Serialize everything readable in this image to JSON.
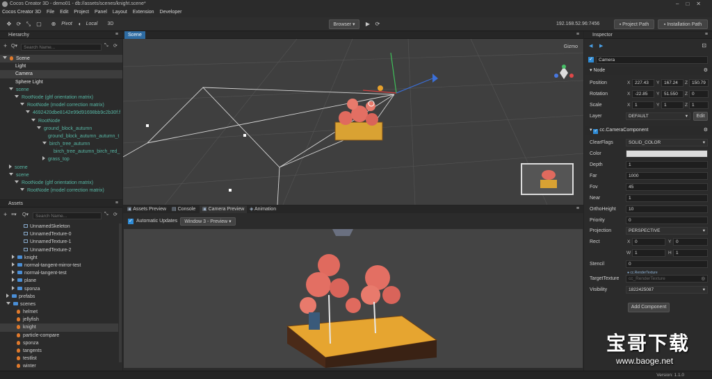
{
  "window": {
    "title": "Cocos Creator 3D - demo01 - db://assets/scenes/knight.scene*"
  },
  "menu": [
    "Cocos Creator 3D",
    "File",
    "Edit",
    "Project",
    "Panel",
    "Layout",
    "Extension",
    "Developer"
  ],
  "toolbar": {
    "pivot": "Pivot",
    "local": "Local",
    "mode3d": "3D",
    "browser": "Browser",
    "ip": "192.168.52.96:7456",
    "project_path": "Project Path",
    "install_path": "Installation Path"
  },
  "hierarchy": {
    "title": "Hierarchy",
    "search_placeholder": "Search Name...",
    "rows": [
      "Scene",
      "Light",
      "Camera",
      "Sphere Light",
      "scene",
      "RootNode (gltf orientation matrix)",
      "RootNode (model correction matrix)",
      "4692420dbe8142e99d91698bb9c2b30f.f",
      "RootNode",
      "ground_block_autumn",
      "ground_block_autumn_autumn_t",
      "birch_tree_autumn",
      "birch_tree_autumn_birch_red_",
      "grass_top",
      "scene",
      "scene",
      "RootNode (gltf orientation matrix)",
      "RootNode (model correction matrix)"
    ]
  },
  "scene": {
    "tab": "Scene",
    "gizmo": "Gizmo"
  },
  "assets": {
    "title": "Assets",
    "search_placeholder": "Search Name...",
    "rows": [
      "UnnamedSkeleton",
      "UnnamedTexture-0",
      "UnnamedTexture-1",
      "UnnamedTexture-2",
      "knight",
      "normal-tangent-mirror-test",
      "normal-tangent-test",
      "plane",
      "sponza",
      "prefabs",
      "scenes",
      "helmet",
      "jellyfish",
      "knight",
      "particle-compare",
      "sponza",
      "tangents",
      "testlist",
      "winter"
    ]
  },
  "bottom_tabs": [
    "Assets Preview",
    "Console",
    "Camera Preview",
    "Animation"
  ],
  "preview": {
    "auto_update": "Automatic Updates",
    "window_select": "Window 3 - Preview"
  },
  "inspector": {
    "title": "Inspector",
    "node_name": "Camera",
    "node_section": "Node",
    "position_label": "Position",
    "position": [
      "227.43",
      "167.24",
      "150.79"
    ],
    "rotation_label": "Rotation",
    "rotation": [
      "-22.85",
      "51.550",
      "0"
    ],
    "scale_label": "Scale",
    "scale": [
      "1",
      "1",
      "1"
    ],
    "layer_label": "Layer",
    "layer": "DEFAULT",
    "edit": "Edit",
    "component": "cc.CameraComponent",
    "props": [
      {
        "label": "ClearFlags",
        "value": "SOLID_COLOR"
      },
      {
        "label": "Color",
        "value": ""
      },
      {
        "label": "Depth",
        "value": "1"
      },
      {
        "label": "Far",
        "value": "1000"
      },
      {
        "label": "Fov",
        "value": "45"
      },
      {
        "label": "Near",
        "value": "1"
      },
      {
        "label": "OrthoHeight",
        "value": "10"
      },
      {
        "label": "Priority",
        "value": "0"
      },
      {
        "label": "Projection",
        "value": "PERSPECTIVE"
      }
    ],
    "rect_label": "Rect",
    "rect": {
      "x": "0",
      "y": "0",
      "w": "1",
      "h": "1"
    },
    "stencil_label": "Stencil",
    "stencil": "0",
    "target_label": "TargetTexture",
    "target_type": "cc.RenderTexture",
    "target_value": "cc_RenderTexture",
    "visibility_label": "Visibility",
    "visibility": "1822425087",
    "add_component": "Add Component"
  },
  "status": {
    "version": "Version: 1.1.0"
  },
  "watermark": {
    "cn": "宝哥下载",
    "url": "www.baoge.net"
  },
  "colors": {
    "accent": "#2e8bd6",
    "teal": "#57b6a4",
    "bg": "#2b2b2b",
    "viewport": "#444444"
  }
}
